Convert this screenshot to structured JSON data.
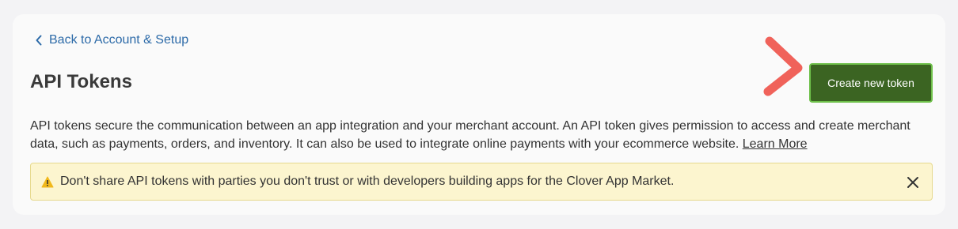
{
  "header": {
    "back_link_label": "Back to Account & Setup",
    "title": "API Tokens",
    "create_button_label": "Create new token"
  },
  "description": {
    "text": "API tokens secure the communication between an app integration and your merchant account. An API token gives permission to access and create merchant data, such as payments, orders, and inventory. It can also be used to integrate online payments with your ecommerce website.",
    "link_label": "Learn More"
  },
  "warning": {
    "message": "Don't share API tokens with parties you don't trust or with developers building apps for the Clover App Market."
  },
  "icons": {
    "back": "chevron-left-icon",
    "warning": "warning-triangle-icon",
    "close": "close-icon",
    "pointer": "annotation-arrow-icon"
  },
  "colors": {
    "link": "#2c6aa8",
    "button_bg": "#3b6422",
    "button_border": "#6ec04a",
    "warning_bg": "#fcf5cf",
    "annotation": "#f0625a"
  }
}
